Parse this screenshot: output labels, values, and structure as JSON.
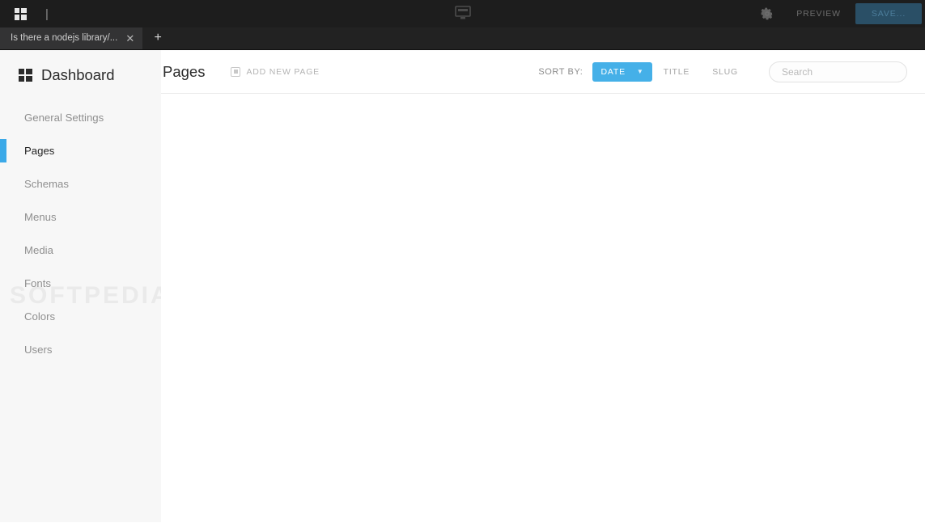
{
  "browser": {
    "app_menu_icon": "grid-apps-icon",
    "caret": "|",
    "center_icon": "monitor-icon",
    "gear_icon": "gear-icon",
    "preview_label": "PREVIEW",
    "save_label": "SAVE...",
    "tabs": [
      {
        "title": "Is there a nodejs library/...",
        "close_icon": "close-icon"
      }
    ],
    "new_tab_icon": "+"
  },
  "sidebar": {
    "brand": {
      "title": "Dashboard",
      "icon": "dashboard-grid-icon"
    },
    "items": [
      {
        "label": "General Settings",
        "active": false
      },
      {
        "label": "Pages",
        "active": true
      },
      {
        "label": "Schemas",
        "active": false
      },
      {
        "label": "Menus",
        "active": false
      },
      {
        "label": "Media",
        "active": false
      },
      {
        "label": "Fonts",
        "active": false
      },
      {
        "label": "Colors",
        "active": false
      },
      {
        "label": "Users",
        "active": false
      }
    ],
    "watermark": "SOFTPEDIA"
  },
  "content": {
    "heading": "Pages",
    "add_new_page": {
      "label": "ADD NEW PAGE",
      "icon": "add-page-icon"
    },
    "sort": {
      "label": "SORT BY:",
      "selected": "DATE",
      "caret_icon": "chevron-down-icon",
      "options": [
        "DATE",
        "TITLE",
        "SLUG"
      ],
      "other_options": [
        "TITLE",
        "SLUG"
      ]
    },
    "search": {
      "placeholder": "Search",
      "value": ""
    },
    "rows": []
  },
  "colors": {
    "accent_blue": "#45b0e8",
    "indicator_blue": "#3ba9e8",
    "header_dark": "#1d1d1d",
    "tabstrip_dark": "#222222",
    "save_button": "#2a4f66",
    "sidebar_bg": "#f7f7f7"
  }
}
